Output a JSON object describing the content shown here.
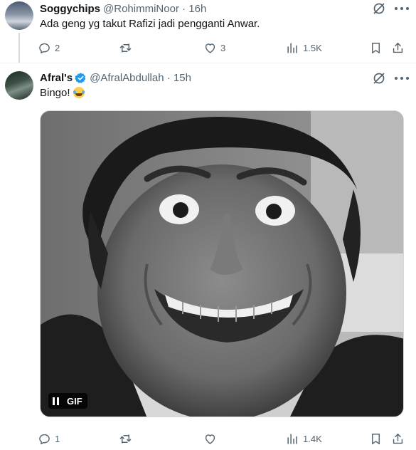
{
  "tweets": [
    {
      "display_name": "Soggychips",
      "handle": "@RohimmiNoor",
      "time": "16h",
      "text": "Ada geng yg takut Rafizi jadi pengganti Anwar.",
      "verified": false,
      "stats": {
        "replies": "2",
        "retweets": "",
        "likes": "3",
        "views": "1.5K"
      }
    },
    {
      "display_name": "Afral's",
      "handle": "@AfralAbdullah",
      "time": "15h",
      "text": "Bingo!",
      "verified": true,
      "emoji": "face-with-tears-of-joy",
      "media": {
        "badge": "GIF"
      },
      "stats": {
        "replies": "1",
        "retweets": "",
        "likes": "",
        "views": "1.4K"
      }
    }
  ],
  "sep": " · ",
  "icons": [
    "grok-icon",
    "more-icon",
    "reply-icon",
    "retweet-icon",
    "like-icon",
    "views-icon",
    "bookmark-icon",
    "share-icon",
    "verified-badge-icon",
    "pause-icon"
  ],
  "colors": {
    "text": "#0f1419",
    "secondary": "#536471",
    "verified": "#1d9bf0",
    "divider": "#eff3f4"
  }
}
